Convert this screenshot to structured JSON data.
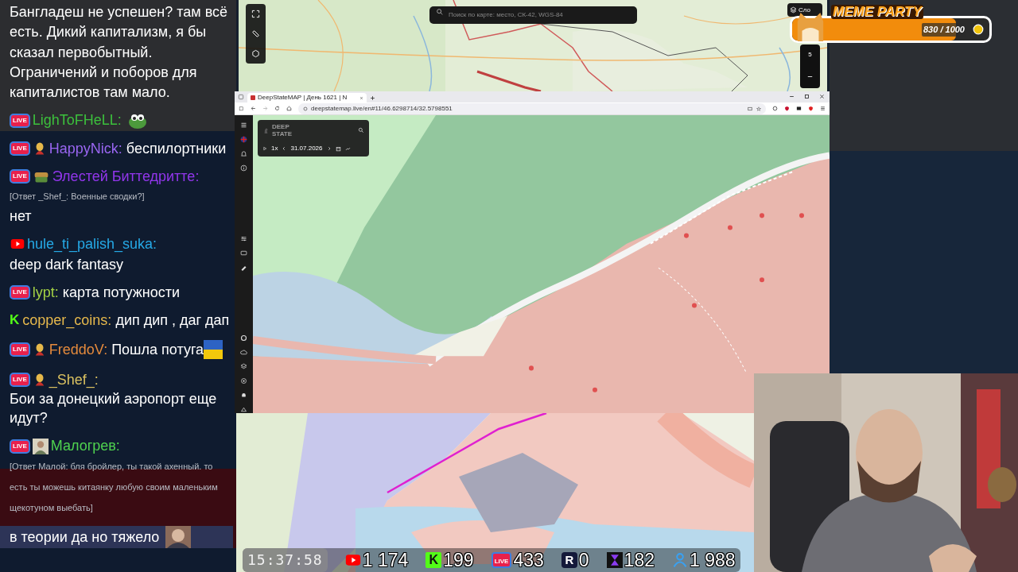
{
  "chat": {
    "messages": [
      {
        "text": "Бангладеш не успешен? там всё есть. Дикий капитализм, я бы сказал первобытный. Ограничений и поборов для капиталистов там мало."
      },
      {
        "badge": {
          "kind": "live",
          "label": "LIVE"
        },
        "name": "LighToFHeLL:",
        "color": "#3cc03c",
        "emote": {
          "kind": "frog"
        }
      },
      {
        "badge": {
          "kind": "live",
          "label": "LIVE"
        },
        "avatar": {
          "kind": "figure"
        },
        "name": "HappyNick:",
        "color": "#9a66f2",
        "text": "беспилортники"
      },
      {
        "badge": {
          "kind": "live",
          "label": "LIVE"
        },
        "avatar": {
          "kind": "cake"
        },
        "name": "Элестей Биттедритте:",
        "color": "#9236ec",
        "reply": "[Ответ _Shef_: Военные сводки?]",
        "text": "нет"
      },
      {
        "badge": {
          "kind": "youtube"
        },
        "name": "hule_ti_palish_suka:",
        "color": "#25a9e6",
        "text": "deep dark fantasy"
      },
      {
        "badge": {
          "kind": "live",
          "label": "LIVE"
        },
        "name": "lypt:",
        "color": "#a4d245",
        "text": "карта потужности"
      },
      {
        "badge": {
          "kind": "kick",
          "label": "K"
        },
        "name": "copper_coins:",
        "color": "#e6b84c",
        "text": "дип дип , даг дап"
      },
      {
        "badge": {
          "kind": "live",
          "label": "LIVE"
        },
        "avatar": {
          "kind": "figure"
        },
        "name": "FreddoV:",
        "color": "#e58a3c",
        "text": "Пошла потуга",
        "emote": {
          "kind": "flag"
        }
      },
      {
        "badge": {
          "kind": "live",
          "label": "LIVE"
        },
        "avatar": {
          "kind": "figure"
        },
        "name": "_Shef_:",
        "color": "#d9c060",
        "text": "Бои за донецкий аэропорт еще идут?"
      },
      {
        "badge": {
          "kind": "live",
          "label": "LIVE"
        },
        "name": "Малогрев:",
        "color": "#4fd24f",
        "reply": "[Ответ Малой: бля бройлер, ты такой ахенный. то есть ты можешь китаянку любую своим маленьким щекотуном выебать]"
      },
      {
        "text": "в теории да но тяжело",
        "emote": {
          "kind": "thumbnail"
        }
      }
    ]
  },
  "top_map": {
    "search": {
      "placeholder": "Поиск по карте: место, СК-42, WGS-84"
    },
    "layers_button": "Сло",
    "zoom_level": "5",
    "zoom_out": "−"
  },
  "meme_party": {
    "title": "MEME PARTY",
    "count": "830 / 1000",
    "level": 0.83
  },
  "browser": {
    "tab": {
      "title": "DeepStateMAP | День 1621 | N",
      "selected": true
    },
    "url": "deepstatemap.live/en#11/46.6298714/32.5798551",
    "panel": {
      "logo": "DEEP STATE",
      "speed": "1x",
      "date": "31.07.2026"
    }
  },
  "stats": {
    "clock": "15:37:58",
    "items": [
      {
        "kind": "youtube",
        "value": "1 174"
      },
      {
        "kind": "kick",
        "label": "K",
        "value": "199"
      },
      {
        "kind": "live",
        "label": "LIVE",
        "value": "433"
      },
      {
        "kind": "rutube",
        "label": "R",
        "value": "0"
      },
      {
        "kind": "hourglass",
        "value": "182"
      },
      {
        "kind": "viewers",
        "value": "1 988"
      }
    ]
  }
}
